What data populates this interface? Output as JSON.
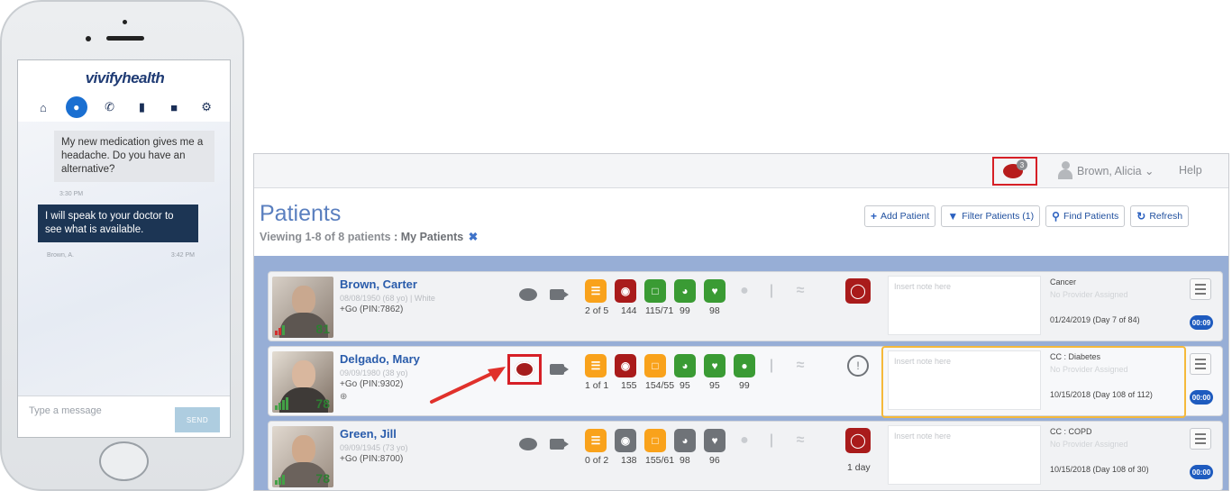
{
  "phone": {
    "brand": "vivifyhealth",
    "nav_icons": [
      "home-icon",
      "chat-icon",
      "phone-icon",
      "signal-icon",
      "book-icon",
      "gear-icon"
    ],
    "messages": [
      {
        "direction": "in",
        "text": "My new medication gives me a headache. Do you have an alternative?",
        "time": "3:30 PM"
      },
      {
        "direction": "out",
        "text": "I will speak to your doctor to see what is available.",
        "sender": "Brown, A.",
        "time": "3:42 PM"
      }
    ],
    "input_placeholder": "Type a message",
    "send_label": "SEND"
  },
  "topbar": {
    "message_count": "3",
    "user_name": "Brown, Alicia",
    "help_label": "Help"
  },
  "page": {
    "title": "Patients",
    "viewing": "Viewing 1-8 of 8 patients",
    "scope": ": My Patients",
    "clear_icon": "✖"
  },
  "toolbar": {
    "add_patient": "Add Patient",
    "filter_patients": "Filter Patients (1)",
    "find_patients": "Find Patients",
    "refresh": "Refresh"
  },
  "patients": [
    {
      "name": "Brown, Carter",
      "dob": "08/08/1950 (68 yo) | White",
      "pin": "+Go (PIN:7862)",
      "score": "81",
      "vitals": [
        "2 of 5",
        "144",
        "115/71",
        "99",
        "98"
      ],
      "alert_sub": "",
      "note_placeholder": "Insert note here",
      "condition": "Cancer",
      "provider": "No Provider Assigned",
      "dates": "01/24/2019 (Day 7 of 84)",
      "timer": "00:09"
    },
    {
      "name": "Delgado, Mary",
      "dob": "09/09/1980 (38 yo)",
      "pin": "+Go (PIN:9302)",
      "extra": "⊕",
      "score": "78",
      "vitals": [
        "1 of 1",
        "155",
        "154/55",
        "95",
        "95",
        "99"
      ],
      "alert_sub": "",
      "note_placeholder": "Insert note here",
      "condition": "CC : Diabetes",
      "provider": "No Provider Assigned",
      "dates": "10/15/2018 (Day 108 of 112)",
      "timer": "00:00"
    },
    {
      "name": "Green, Jill",
      "dob": "09/09/1945 (73 yo)",
      "pin": "+Go (PIN:8700)",
      "score": "78",
      "vitals": [
        "0 of 2",
        "138",
        "155/61",
        "98",
        "96"
      ],
      "alert_sub": "1 day",
      "note_placeholder": "Insert note here",
      "condition": "CC : COPD",
      "provider": "No Provider Assigned",
      "dates": "10/15/2018 (Day 108 of 30)",
      "timer": "00:00"
    }
  ],
  "colors": {
    "accent_blue": "#2a5cab",
    "alert_red": "#a91b1b",
    "vital_orange": "#f9a21b",
    "vital_green": "#3a9b34",
    "highlight_red": "#d61f26",
    "selected_border": "#f5b93a"
  }
}
